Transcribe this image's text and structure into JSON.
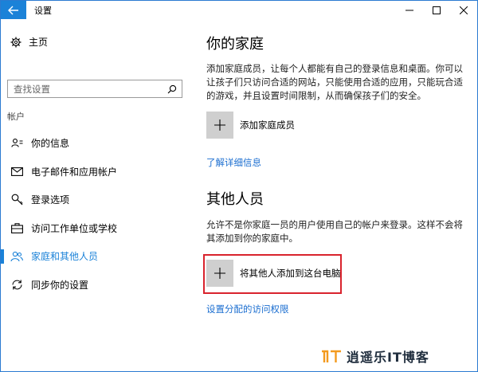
{
  "window": {
    "title": "设置"
  },
  "sidebar": {
    "home_label": "主页",
    "search_placeholder": "查找设置",
    "section_label": "帐户",
    "items": [
      {
        "label": "你的信息",
        "icon": "person-card-icon"
      },
      {
        "label": "电子邮件和应用帐户",
        "icon": "mail-icon"
      },
      {
        "label": "登录选项",
        "icon": "key-icon"
      },
      {
        "label": "访问工作单位或学校",
        "icon": "briefcase-icon"
      },
      {
        "label": "家庭和其他人员",
        "icon": "people-icon",
        "active": true
      },
      {
        "label": "同步你的设置",
        "icon": "sync-icon"
      }
    ]
  },
  "main": {
    "family": {
      "title": "你的家庭",
      "description": "添加家庭成员，让每个人都能有自己的登录信息和桌面。你可以让孩子们只访问合适的网站，只能使用合适的应用，只能玩合适的游戏，并且设置时间限制，从而确保孩子们的安全。",
      "add_label": "添加家庭成员",
      "link": "了解详细信息"
    },
    "others": {
      "title": "其他人员",
      "description": "允许不是你家庭一员的用户使用自己的帐户来登录。这样不会将其添加到你的家庭中。",
      "add_label": "将其他人添加到这台电脑",
      "link": "设置分配的访问权限"
    }
  },
  "watermark": {
    "badge": "IT",
    "text": "逍遥乐IT博客"
  },
  "colors": {
    "accent": "#1b82d8",
    "link": "#1b6ed0",
    "highlight": "#d9232d",
    "tile": "#cfcfcf"
  }
}
